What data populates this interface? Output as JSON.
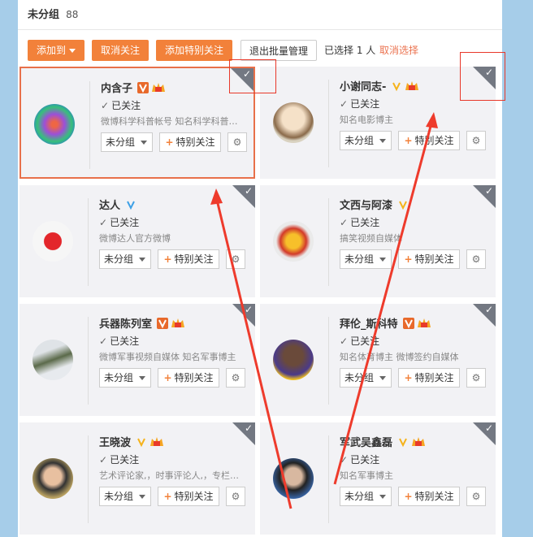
{
  "header": {
    "title": "未分组",
    "count": "88"
  },
  "toolbar": {
    "add_to": "添加到",
    "unfollow": "取消关注",
    "add_special": "添加特别关注",
    "exit_batch": "退出批量管理",
    "selected": "已选择 1 人",
    "cancel_select": "取消选择"
  },
  "cards": [
    {
      "name": "内含子",
      "followed": "已关注",
      "desc": "微博科学科普帐号 知名科学科普…",
      "group": "未分组",
      "special": "特别关注",
      "verify": "orange",
      "crown": true
    },
    {
      "name": "小谢同志-",
      "followed": "已关注",
      "desc": "知名电影博主",
      "group": "未分组",
      "special": "特别关注",
      "verify": "yellow",
      "crown": true
    },
    {
      "name": "达人",
      "followed": "已关注",
      "desc": "微博达人官方微博",
      "group": "未分组",
      "special": "特别关注",
      "verify": "blue",
      "crown": false
    },
    {
      "name": "文西与阿漆",
      "followed": "已关注",
      "desc": "搞笑视频自媒体",
      "group": "未分组",
      "special": "特别关注",
      "verify": "yellow",
      "crown": false
    },
    {
      "name": "兵器陈列室",
      "followed": "已关注",
      "desc": "微博军事视频自媒体 知名军事博主",
      "group": "未分组",
      "special": "特别关注",
      "verify": "orange",
      "crown": true
    },
    {
      "name": "拜伦_斯科特",
      "followed": "已关注",
      "desc": "知名体育博主 微博签约自媒体",
      "group": "未分组",
      "special": "特别关注",
      "verify": "orange",
      "crown": true
    },
    {
      "name": "王晓波",
      "followed": "已关注",
      "desc": "艺术评论家,，时事评论人,，专栏…",
      "group": "未分组",
      "special": "特别关注",
      "verify": "yellow",
      "crown": true
    },
    {
      "name": "军武吴鑫磊",
      "followed": "已关注",
      "desc": "知名军事博主",
      "group": "未分组",
      "special": "特别关注",
      "verify": "yellow",
      "crown": true
    }
  ],
  "colors": {
    "accent": "#f2813a",
    "annotation_red": "#e8382a",
    "corner_gray": "#737882"
  }
}
